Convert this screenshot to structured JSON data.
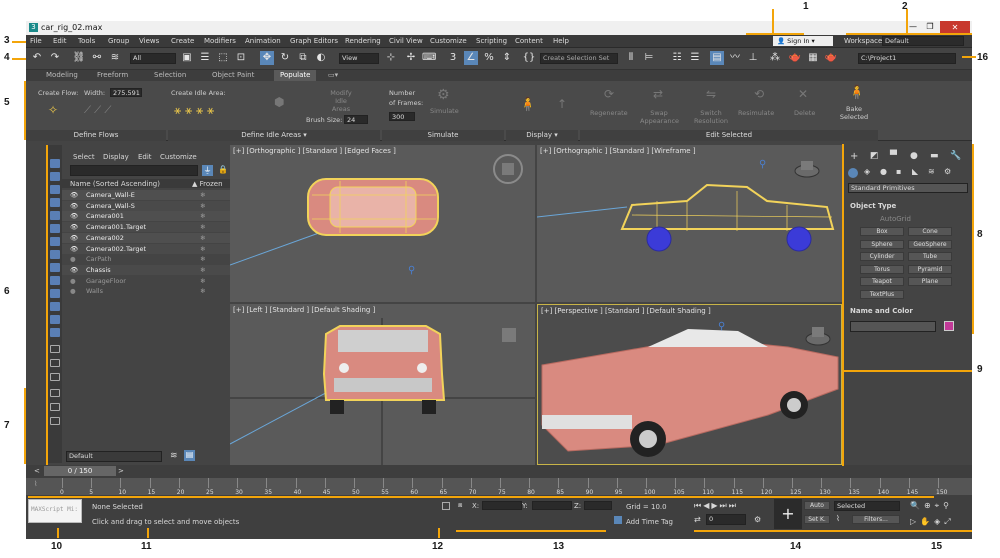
{
  "window": {
    "title": "car_rig_02.max",
    "minimize": "—",
    "maximize": "❐",
    "close": "✕"
  },
  "menubar": {
    "items": [
      "File",
      "Edit",
      "Tools",
      "Group",
      "Views",
      "Create",
      "Modifiers",
      "Animation",
      "Graph Editors",
      "Rendering",
      "Civil View",
      "Customize",
      "Scripting",
      "Content",
      "Help"
    ],
    "signin": "Sign In",
    "workspaces_label": "Workspaces:",
    "workspaces_value": "Default"
  },
  "toolbar": {
    "filter_value": "All",
    "refcoord_value": "View",
    "selset_placeholder": "Create Selection Set",
    "project_path": "C:\\Project1"
  },
  "ribbon": {
    "tabs": [
      "Modeling",
      "Freeform",
      "Selection",
      "Object Paint",
      "Populate"
    ],
    "active_tab": "Populate",
    "create_flow": "Create Flow:",
    "width_label": "Width:",
    "width_value": "275.591",
    "create_idle": "Create Idle Area:",
    "modify_idle": "Modify Idle Areas",
    "brush_label": "Brush Size:",
    "brush_value": "24",
    "frames_label1": "Number",
    "frames_label2": "of Frames:",
    "frames_value": "300",
    "simulate": "Simulate",
    "regenerate": "Regenerate",
    "swap": "Swap Appearance",
    "switch": "Switch Resolution",
    "resimulate": "Resimulate",
    "delete": "Delete",
    "bake": "Bake Selected",
    "panels": [
      "Define Flows",
      "Define Idle Areas ▾",
      "Simulate",
      "Display ▾",
      "Edit Selected"
    ]
  },
  "scene_explorer": {
    "menu": [
      "Select",
      "Display",
      "Edit",
      "Customize"
    ],
    "col_name": "Name (Sorted Ascending)",
    "col_frozen": "▲ Frozen",
    "rows": [
      {
        "name": "Camera_Wall-E",
        "dim": false
      },
      {
        "name": "Camera_Wall-S",
        "dim": false
      },
      {
        "name": "Camera001",
        "dim": false
      },
      {
        "name": "Camera001.Target",
        "dim": false
      },
      {
        "name": "Camera002",
        "dim": false
      },
      {
        "name": "Camera002.Target",
        "dim": false
      },
      {
        "name": "CarPath",
        "dim": true
      },
      {
        "name": "Chassis",
        "dim": false
      },
      {
        "name": "GarageFloor",
        "dim": true
      },
      {
        "name": "Walls",
        "dim": true
      }
    ],
    "layer": "Default"
  },
  "viewports": {
    "top_left": "[+] [Orthographic ] [Standard ] [Edged Faces ]",
    "top_right": "[+] [Orthographic ] [Standard ] [Wireframe ]",
    "bottom_left": "[+] [Left ] [Standard ] [Default Shading ]",
    "bottom_right": "[+] [Perspective ] [Standard ] [Default Shading ]"
  },
  "command_panel": {
    "dropdown": "Standard Primitives",
    "object_type": "Object Type",
    "autogrid": "AutoGrid",
    "buttons": [
      "Box",
      "Cone",
      "Sphere",
      "GeoSphere",
      "Cylinder",
      "Tube",
      "Torus",
      "Pyramid",
      "Teapot",
      "Plane",
      "TextPlus"
    ],
    "name_color": "Name and Color"
  },
  "timeline": {
    "frame": "0 / 150",
    "ticks": [
      "0",
      "5",
      "10",
      "15",
      "20",
      "25",
      "30",
      "35",
      "40",
      "45",
      "50",
      "55",
      "60",
      "65",
      "70",
      "75",
      "80",
      "85",
      "90",
      "95",
      "100",
      "105",
      "110",
      "115",
      "120",
      "125",
      "130",
      "135",
      "140",
      "145",
      "150"
    ]
  },
  "status": {
    "maxscript": "MAXScript Mi:",
    "selection": "None Selected",
    "prompt": "Click and drag to select and move objects",
    "x_label": "X:",
    "y_label": "Y:",
    "z_label": "Z:",
    "grid": "Grid = 10.0",
    "add_time_tag": "Add Time Tag",
    "auto": "Auto",
    "setk": "Set K.",
    "selected": "Selected",
    "filters": "Filters...",
    "frame_field": "0"
  },
  "callouts": [
    "1",
    "2",
    "3",
    "4",
    "5",
    "6",
    "7",
    "8",
    "9",
    "10",
    "11",
    "12",
    "13",
    "14",
    "15",
    "16"
  ],
  "colors": {
    "accent": "#f3a50a",
    "selection": "#e8c84a",
    "active": "#5a87b8",
    "car": "#d98080"
  }
}
